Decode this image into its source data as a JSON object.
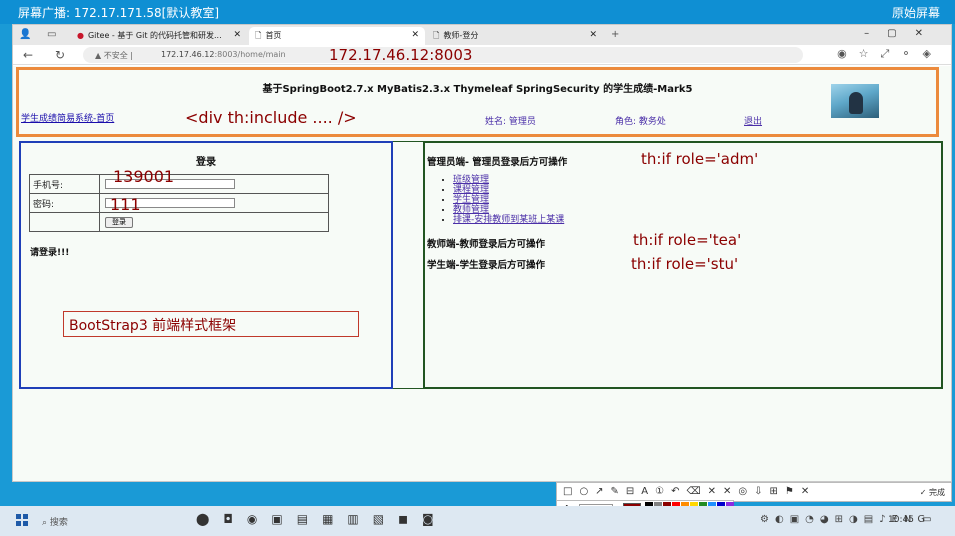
{
  "broadcast": {
    "title": "屏幕广播: 172.17.171.58[默认教室]",
    "right_label": "原始屏幕"
  },
  "browser": {
    "tabs": [
      {
        "label": "Gitee - 基于 Git 的代码托管和研发...",
        "icon": "gitee-icon"
      },
      {
        "label": "首页",
        "icon": "page-icon",
        "active": true
      },
      {
        "label": "教师-登分",
        "icon": "page-icon"
      }
    ],
    "new_tab": "+",
    "address": {
      "warning": "不安全",
      "host": "172.17.46.12",
      "port_path": ":8003/home/main"
    },
    "annotation": "172.17.46.12:8003"
  },
  "header": {
    "title": "基于SpringBoot2.7.x MyBatis2.3.x Thymeleaf SpringSecurity 的学生成绩-Mark5",
    "home_link": "学生成绩简易系统-首页",
    "include_annotation": "<div th:include     .... />",
    "user_name": "姓名: 管理员",
    "user_role": "角色: 教务处",
    "logout": "退出"
  },
  "login": {
    "title": "登录",
    "phone_label": "手机号:",
    "password_label": "密码:",
    "submit": "登录",
    "phone_annotation": "139001",
    "password_annotation": "111",
    "message": "请登录!!!",
    "bootstrap_annotation": "BootStrap3 前端样式框架"
  },
  "ops": {
    "admin_title": "管理员端- 管理员登录后方可操作",
    "admin_annotation": "th:if  role='adm'",
    "admin_items": [
      "班级管理",
      "课程管理",
      "学生管理",
      "教师管理",
      "排课-安排教师到某班上某课"
    ],
    "teacher_title": "教师端-教师登录后方可操作",
    "teacher_annotation": "th:if role='tea'",
    "student_title": "学生端-学生登录后方可操作",
    "student_annotation": "th:if role='stu'"
  },
  "annotation_toolbar": {
    "done": "完成",
    "font_size": "22",
    "current_color": "#8b0000",
    "palette": [
      "#000000",
      "#808080",
      "#8b0000",
      "#ff0000",
      "#ff8c00",
      "#ffd700",
      "#228b22",
      "#1e90ff",
      "#0000cd",
      "#8a2be2",
      "#ffffff",
      "#c0c0c0",
      "#ff69b4",
      "#ffa07a",
      "#f0e68c",
      "#ffff00",
      "#7cfc00",
      "#00ced1",
      "#4169e1",
      "#00bfff"
    ]
  },
  "taskbar": {
    "search": "搜索",
    "time": "10:45"
  }
}
